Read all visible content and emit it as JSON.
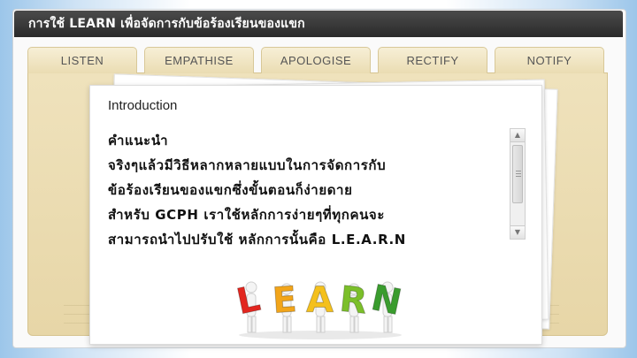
{
  "window": {
    "title": "การใช้ LEARN เพื่อจัดการกับข้อร้องเรียนของแขก"
  },
  "tabs": [
    {
      "label": "LISTEN"
    },
    {
      "label": "EMPATHISE"
    },
    {
      "label": "APOLOGISE"
    },
    {
      "label": "RECTIFY"
    },
    {
      "label": "NOTIFY"
    }
  ],
  "content": {
    "title": "Introduction",
    "lines": [
      "คำแนะนำ",
      "จริงๆแล้วมีวิธีหลากหลายแบบในการจัดการกับ",
      "ข้อร้องเรียนของแขกซึ่งขั้นตอนก็ง่ายดาย",
      "สำหรับ GCPH เราใช้หลักการง่ายๆที่ทุกคนจะ",
      "สามารถนำไปปรับใช้ หลักการนั้นคือ L.E.A.R.N"
    ]
  },
  "illustration": {
    "name": "learn-people-carrying-letters",
    "letters": [
      "L",
      "E",
      "A",
      "R",
      "N"
    ],
    "colors": [
      "#e2261f",
      "#f2a51a",
      "#f4c01c",
      "#7bbf2a",
      "#3a9c2e"
    ]
  },
  "colors": {
    "titlebar": "#333333",
    "tab": "#efe2bc",
    "folder": "#e9d9ac"
  }
}
